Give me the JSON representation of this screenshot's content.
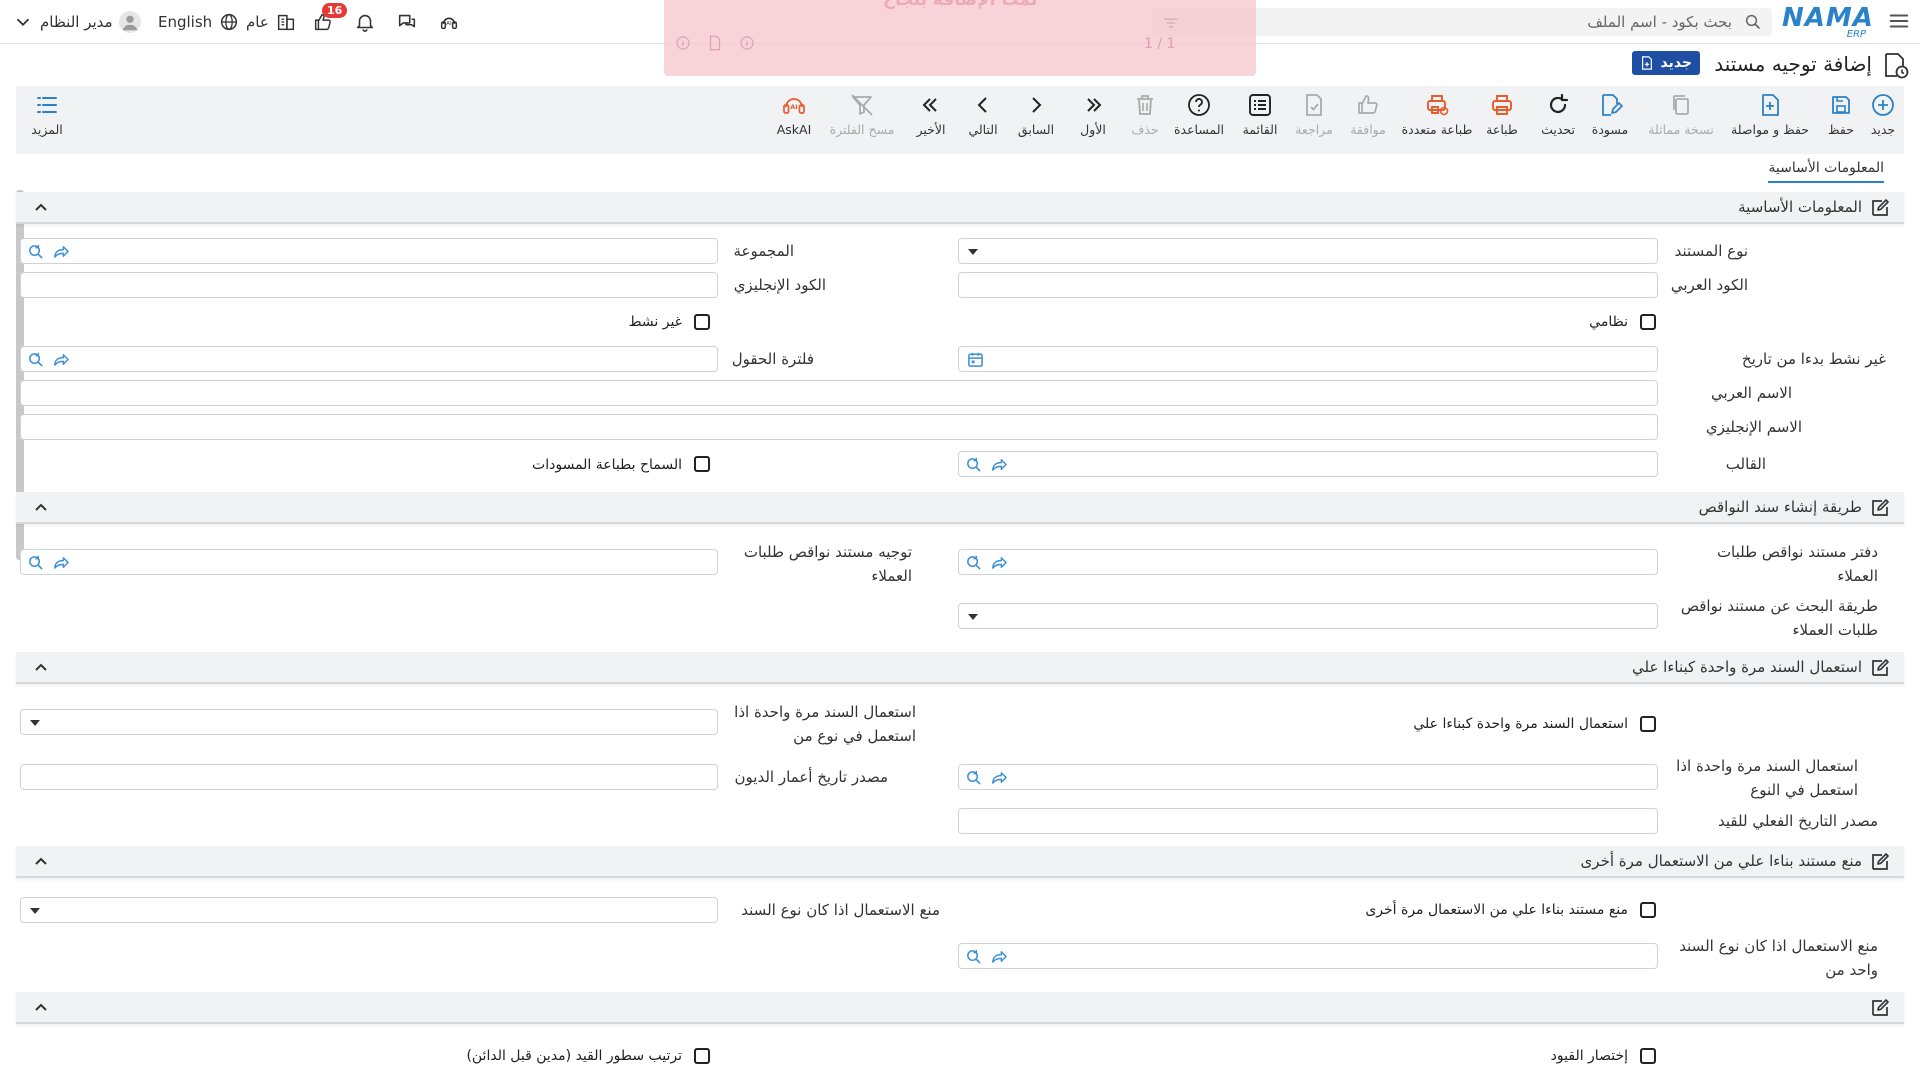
{
  "topbar": {
    "logo": "NAMA",
    "logo_sub": "ERP",
    "search_placeholder": "بحث بكود - اسم الملف",
    "language": "English",
    "branch": "عام",
    "notifications_count": "16",
    "user": "مدير النظام"
  },
  "toast": {
    "title": "تمت الإضافة بنجاح",
    "count": "1 / 1"
  },
  "page": {
    "title": "إضافة توجيه مستند",
    "new_badge": "جديد"
  },
  "toolbar": {
    "new": "جديد",
    "save": "حفظ",
    "save_continue": "حفظ و مواصلة",
    "copy": "نسخة مماثلة",
    "draft": "مسودة",
    "refresh": "تحديث",
    "print": "طباعة",
    "multi_print": "طباعة متعددة",
    "approve": "موافقة",
    "review": "مراجعة",
    "list": "القائمة",
    "help": "المساعدة",
    "delete": "حذف",
    "first": "الأول",
    "prev": "السابق",
    "next": "التالي",
    "last": "الأخير",
    "clear_filter": "مسح الفلترة",
    "askai": "AskAI",
    "more": "المزيد"
  },
  "tabs": {
    "basic": "المعلومات الأساسية"
  },
  "section_basic": {
    "title": "المعلومات الأساسية",
    "doc_type": "نوع المستند",
    "group": "المجموعة",
    "arabic_code": "الكود العربي",
    "english_code": "الكود الإنجليزي",
    "system": "نظامي",
    "inactive": "غير نشط",
    "inactive_from": "غير نشط بدءا من تاريخ",
    "fields_filter": "فلترة الحقول",
    "arabic_name": "الاسم العربي",
    "english_name": "الاسم الإنجليزي",
    "template": "القالب",
    "allow_print_drafts": "السماح بطباعة المسودات"
  },
  "section_shortage": {
    "title": "طريقة إنشاء سند النواقص",
    "book_line1": "دفتر مستند نواقص طلبات",
    "book_line2": "العملاء",
    "direct_line1": "توجيه مستند نواقص طلبات",
    "direct_line2": "العملاء",
    "search_line1": "طريقة البحث عن مستند نواقص",
    "search_line2": "طلبات العملاء"
  },
  "section_once": {
    "title": "استعمال السند مرة واحدة كبناءا علي",
    "use_once": "استعمال السند مرة واحدة كبناءا علي",
    "if_from_type_line1": "استعمال السند مرة واحدة اذا",
    "if_from_type_line2": "استعمل في نوع من",
    "if_in_type_line1": "استعمال السند مرة واحدة اذا",
    "if_in_type_line2": "استعمل في النوع",
    "aging_source": "مصدر تاريخ أعمار الديون",
    "actual_date_source": "مصدر التاريخ الفعلي للقيد"
  },
  "section_prevent": {
    "title": "منع مستند بناءا علي من الاستعمال مرة أخرى",
    "prevent_chk": "منع مستند بناءا علي من الاستعمال مرة أخرى",
    "prevent_if_type": "منع الاستعمال اذا كان نوع السند",
    "prevent_if_one_line1": "منع الاستعمال اذا كان نوع السند",
    "prevent_if_one_line2": "واحد من"
  },
  "section_last": {
    "shorten_entries": "إختصار القيود",
    "sort_lines": "ترتيب سطور القيد (مدين قبل الدائن)"
  }
}
